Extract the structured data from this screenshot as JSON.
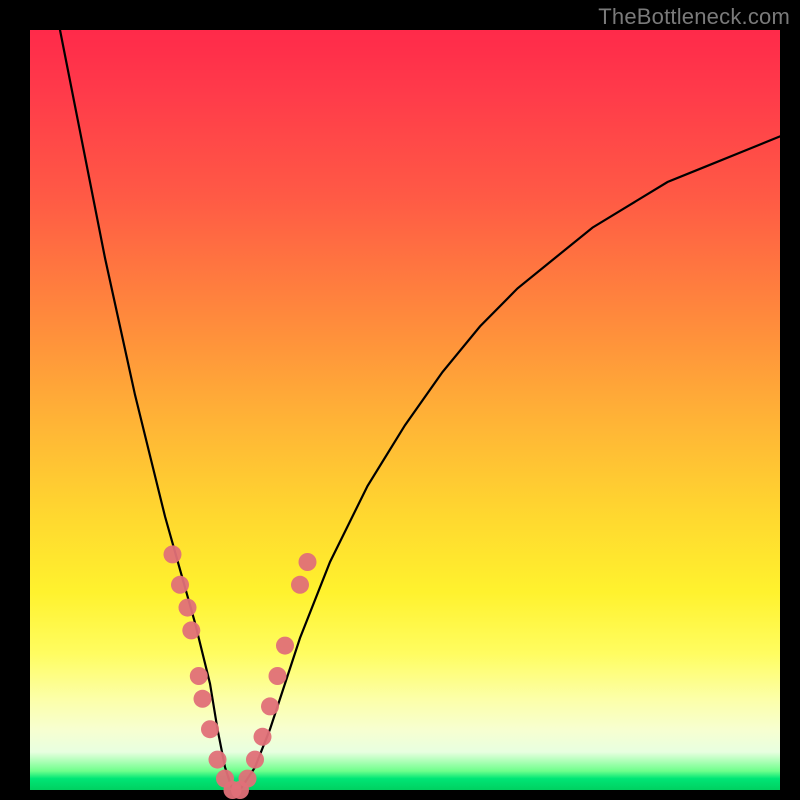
{
  "watermark": "TheBottleneck.com",
  "chart_data": {
    "type": "line",
    "title": "",
    "xlabel": "",
    "ylabel": "",
    "xlim": [
      0,
      100
    ],
    "ylim": [
      0,
      100
    ],
    "grid": false,
    "legend": false,
    "series": [
      {
        "name": "bottleneck-curve",
        "color": "#000000",
        "x": [
          4,
          6,
          8,
          10,
          12,
          14,
          16,
          18,
          20,
          22,
          24,
          25,
          26,
          27,
          28,
          30,
          32,
          34,
          36,
          40,
          45,
          50,
          55,
          60,
          65,
          70,
          75,
          80,
          85,
          90,
          95,
          100
        ],
        "y": [
          100,
          90,
          80,
          70,
          61,
          52,
          44,
          36,
          29,
          22,
          14,
          8,
          3,
          0,
          0,
          3,
          8,
          14,
          20,
          30,
          40,
          48,
          55,
          61,
          66,
          70,
          74,
          77,
          80,
          82,
          84,
          86
        ]
      }
    ],
    "markers": [
      {
        "name": "highlight-dots",
        "color": "#e07078",
        "shape": "circle",
        "points": [
          {
            "x": 19,
            "y": 31
          },
          {
            "x": 20,
            "y": 27
          },
          {
            "x": 21,
            "y": 24
          },
          {
            "x": 21.5,
            "y": 21
          },
          {
            "x": 22.5,
            "y": 15
          },
          {
            "x": 23,
            "y": 12
          },
          {
            "x": 24,
            "y": 8
          },
          {
            "x": 25,
            "y": 4
          },
          {
            "x": 26,
            "y": 1.5
          },
          {
            "x": 27,
            "y": 0
          },
          {
            "x": 28,
            "y": 0
          },
          {
            "x": 29,
            "y": 1.5
          },
          {
            "x": 30,
            "y": 4
          },
          {
            "x": 31,
            "y": 7
          },
          {
            "x": 32,
            "y": 11
          },
          {
            "x": 33,
            "y": 15
          },
          {
            "x": 34,
            "y": 19
          },
          {
            "x": 36,
            "y": 27
          },
          {
            "x": 37,
            "y": 30
          }
        ]
      }
    ]
  }
}
